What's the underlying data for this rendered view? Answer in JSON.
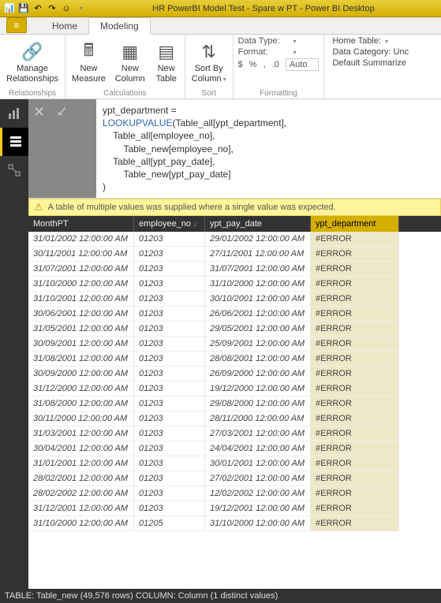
{
  "titlebar": {
    "title": "HR PowerBI Model Test - Spare w PT - Power BI Desktop"
  },
  "tabs": {
    "file": "≡",
    "home": "Home",
    "modeling": "Modeling"
  },
  "ribbon": {
    "relationships": {
      "manage": "Manage\nRelationships",
      "group": "Relationships"
    },
    "calc": {
      "measure": "New\nMeasure",
      "column": "New\nColumn",
      "table": "New\nTable",
      "group": "Calculations"
    },
    "sort": {
      "sortby": "Sort By\nColumn",
      "group": "Sort"
    },
    "fmt": {
      "datatype": "Data Type:",
      "format": "Format:",
      "auto": "Auto",
      "group": "Formatting",
      "currency": "$",
      "percent": "%",
      "comma": ",",
      "dec": ".0"
    },
    "prop": {
      "hometable": "Home Table:",
      "datacat": "Data Category: Unc",
      "summ": "Default Summarize"
    }
  },
  "formula": {
    "line1_name": "ypt_department",
    "line1_eq": " =",
    "line2_fn": "LOOKUPVALUE",
    "line2_arg": "(Table_all[ypt_department],",
    "line3": "    Table_all[employee_no],",
    "line4": "        Table_new[employee_no],",
    "line5": "    Table_all[ypt_pay_date],",
    "line6": "        Table_new[ypt_pay_date]",
    "line7": ")"
  },
  "error": "A table of multiple values was supplied where a single value was expected.",
  "headers": [
    "MonthPT",
    "employee_no",
    "ypt_pay_date",
    "ypt_department"
  ],
  "chart_data": {
    "type": "table",
    "columns": [
      "MonthPT",
      "employee_no",
      "ypt_pay_date",
      "ypt_department"
    ],
    "rows": [
      [
        "31/01/2002 12:00:00 AM",
        "01203",
        "29/01/2002 12:00:00 AM",
        "#ERROR"
      ],
      [
        "30/11/2001 12:00:00 AM",
        "01203",
        "27/11/2001 12:00:00 AM",
        "#ERROR"
      ],
      [
        "31/07/2001 12:00:00 AM",
        "01203",
        "31/07/2001 12:00:00 AM",
        "#ERROR"
      ],
      [
        "31/10/2000 12:00:00 AM",
        "01203",
        "31/10/2000 12:00:00 AM",
        "#ERROR"
      ],
      [
        "31/10/2001 12:00:00 AM",
        "01203",
        "30/10/2001 12:00:00 AM",
        "#ERROR"
      ],
      [
        "30/06/2001 12:00:00 AM",
        "01203",
        "26/06/2001 12:00:00 AM",
        "#ERROR"
      ],
      [
        "31/05/2001 12:00:00 AM",
        "01203",
        "29/05/2001 12:00:00 AM",
        "#ERROR"
      ],
      [
        "30/09/2001 12:00:00 AM",
        "01203",
        "25/09/2001 12:00:00 AM",
        "#ERROR"
      ],
      [
        "31/08/2001 12:00:00 AM",
        "01203",
        "28/08/2001 12:00:00 AM",
        "#ERROR"
      ],
      [
        "30/09/2000 12:00:00 AM",
        "01203",
        "26/09/2000 12:00:00 AM",
        "#ERROR"
      ],
      [
        "31/12/2000 12:00:00 AM",
        "01203",
        "19/12/2000 12:00:00 AM",
        "#ERROR"
      ],
      [
        "31/08/2000 12:00:00 AM",
        "01203",
        "29/08/2000 12:00:00 AM",
        "#ERROR"
      ],
      [
        "30/11/2000 12:00:00 AM",
        "01203",
        "28/11/2000 12:00:00 AM",
        "#ERROR"
      ],
      [
        "31/03/2001 12:00:00 AM",
        "01203",
        "27/03/2001 12:00:00 AM",
        "#ERROR"
      ],
      [
        "30/04/2001 12:00:00 AM",
        "01203",
        "24/04/2001 12:00:00 AM",
        "#ERROR"
      ],
      [
        "31/01/2001 12:00:00 AM",
        "01203",
        "30/01/2001 12:00:00 AM",
        "#ERROR"
      ],
      [
        "28/02/2001 12:00:00 AM",
        "01203",
        "27/02/2001 12:00:00 AM",
        "#ERROR"
      ],
      [
        "28/02/2002 12:00:00 AM",
        "01203",
        "12/02/2002 12:00:00 AM",
        "#ERROR"
      ],
      [
        "31/12/2001 12:00:00 AM",
        "01203",
        "19/12/2001 12:00:00 AM",
        "#ERROR"
      ],
      [
        "31/10/2000 12:00:00 AM",
        "01205",
        "31/10/2000 12:00:00 AM",
        "#ERROR"
      ]
    ]
  },
  "status": "TABLE: Table_new (49,576 rows) COLUMN: Column (1 distinct values)"
}
